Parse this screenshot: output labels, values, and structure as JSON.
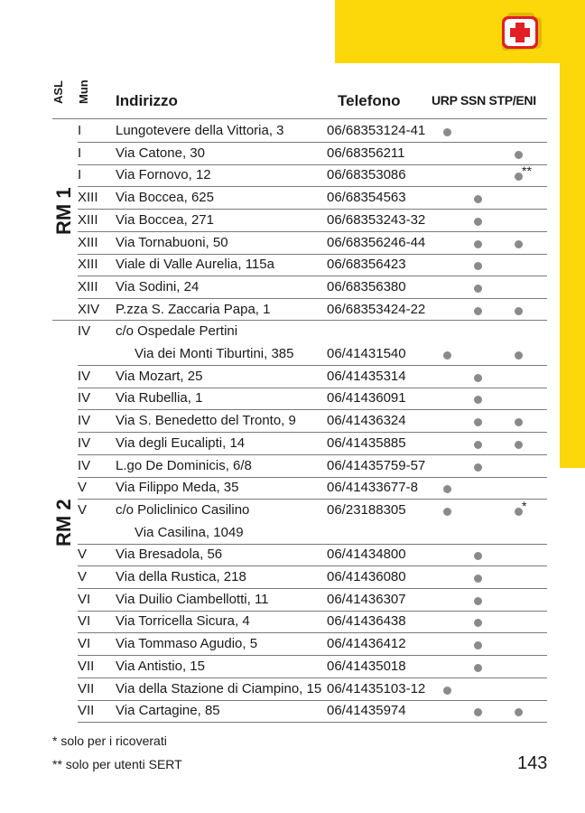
{
  "header": {
    "asl": "ASL",
    "mun": "Mun",
    "indirizzo": "Indirizzo",
    "telefono": "Telefono",
    "cols": "URP SSN STP/ENI"
  },
  "icon": "first-aid-icon",
  "colors": {
    "accent": "#fcd70a",
    "icon_red": "#e31e24",
    "dot": "#8a8a8a"
  },
  "groups": [
    {
      "label": "RM 1",
      "rows": [
        {
          "mun": "I",
          "addr": "Lungotevere della Vittoria, 3",
          "phone": "06/68353124-41",
          "urp": true,
          "ssn": false,
          "stp": false,
          "note": ""
        },
        {
          "mun": "I",
          "addr": "Via Catone, 30",
          "phone": "06/68356211",
          "urp": false,
          "ssn": false,
          "stp": true,
          "note": ""
        },
        {
          "mun": "I",
          "addr": "Via Fornovo, 12",
          "phone": "06/68353086",
          "urp": false,
          "ssn": false,
          "stp": true,
          "note": "**"
        },
        {
          "mun": "XIII",
          "addr": "Via Boccea, 625",
          "phone": "06/68354563",
          "urp": false,
          "ssn": true,
          "stp": false,
          "note": ""
        },
        {
          "mun": "XIII",
          "addr": "Via Boccea, 271",
          "phone": "06/68353243-32",
          "urp": false,
          "ssn": true,
          "stp": false,
          "note": ""
        },
        {
          "mun": "XIII",
          "addr": "Via Tornabuoni, 50",
          "phone": "06/68356246-44",
          "urp": false,
          "ssn": true,
          "stp": true,
          "note": ""
        },
        {
          "mun": "XIII",
          "addr": "Viale di Valle Aurelia, 115a",
          "phone": "06/68356423",
          "urp": false,
          "ssn": true,
          "stp": false,
          "note": ""
        },
        {
          "mun": "XIII",
          "addr": "Via Sodini, 24",
          "phone": "06/68356380",
          "urp": false,
          "ssn": true,
          "stp": false,
          "note": ""
        },
        {
          "mun": "XIV",
          "addr": "P.zza S. Zaccaria Papa, 1",
          "phone": "06/68353424-22",
          "urp": false,
          "ssn": true,
          "stp": true,
          "note": ""
        }
      ]
    },
    {
      "label": "RM 2",
      "rows": [
        {
          "mun": "IV",
          "addr": "c/o Ospedale Pertini",
          "phone": "",
          "urp": false,
          "ssn": false,
          "stp": false,
          "note": ""
        },
        {
          "mun": "",
          "addr": "Via dei Monti Tiburtini, 385",
          "phone": "06/41431540",
          "urp": true,
          "ssn": false,
          "stp": true,
          "note": ""
        },
        {
          "mun": "IV",
          "addr": "Via Mozart, 25",
          "phone": "06/41435314",
          "urp": false,
          "ssn": true,
          "stp": false,
          "note": ""
        },
        {
          "mun": "IV",
          "addr": "Via Rubellia, 1",
          "phone": "06/41436091",
          "urp": false,
          "ssn": true,
          "stp": false,
          "note": ""
        },
        {
          "mun": "IV",
          "addr": "Via S. Benedetto del Tronto, 9",
          "phone": "06/41436324",
          "urp": false,
          "ssn": true,
          "stp": true,
          "note": ""
        },
        {
          "mun": "IV",
          "addr": "Via degli Eucalipti, 14",
          "phone": "06/41435885",
          "urp": false,
          "ssn": true,
          "stp": true,
          "note": ""
        },
        {
          "mun": "IV",
          "addr": "L.go De Dominicis, 6/8",
          "phone": "06/41435759-57",
          "urp": false,
          "ssn": true,
          "stp": false,
          "note": ""
        },
        {
          "mun": "V",
          "addr": "Via Filippo Meda, 35",
          "phone": "06/41433677-8",
          "urp": true,
          "ssn": false,
          "stp": false,
          "note": ""
        },
        {
          "mun": "V",
          "addr": "c/o Policlinico Casilino",
          "phone": "06/23188305",
          "urp": true,
          "ssn": false,
          "stp": true,
          "note": "*"
        },
        {
          "mun": "",
          "addr": "Via Casilina, 1049",
          "phone": "",
          "urp": false,
          "ssn": false,
          "stp": false,
          "note": ""
        },
        {
          "mun": "V",
          "addr": "Via Bresadola, 56",
          "phone": "06/41434800",
          "urp": false,
          "ssn": true,
          "stp": false,
          "note": ""
        },
        {
          "mun": "V",
          "addr": "Via della Rustica, 218",
          "phone": "06/41436080",
          "urp": false,
          "ssn": true,
          "stp": false,
          "note": ""
        },
        {
          "mun": "VI",
          "addr": "Via Duilio Ciambellotti, 11",
          "phone": "06/41436307",
          "urp": false,
          "ssn": true,
          "stp": false,
          "note": ""
        },
        {
          "mun": "VI",
          "addr": "Via Torricella Sicura, 4",
          "phone": "06/41436438",
          "urp": false,
          "ssn": true,
          "stp": false,
          "note": ""
        },
        {
          "mun": "VI",
          "addr": "Via Tommaso Agudio, 5",
          "phone": "06/41436412",
          "urp": false,
          "ssn": true,
          "stp": false,
          "note": ""
        },
        {
          "mun": "VII",
          "addr": "Via Antistio, 15",
          "phone": "06/41435018",
          "urp": false,
          "ssn": true,
          "stp": false,
          "note": ""
        },
        {
          "mun": "VII",
          "addr": "Via della Stazione di Ciampino, 15",
          "phone": "06/41435103-12",
          "urp": true,
          "ssn": false,
          "stp": false,
          "note": ""
        },
        {
          "mun": "VII",
          "addr": "Via Cartagine, 85",
          "phone": "06/41435974",
          "urp": false,
          "ssn": true,
          "stp": true,
          "note": ""
        }
      ]
    }
  ],
  "footnotes": [
    "* solo per i ricoverati",
    "** solo per utenti SERT"
  ],
  "page_number": "143"
}
